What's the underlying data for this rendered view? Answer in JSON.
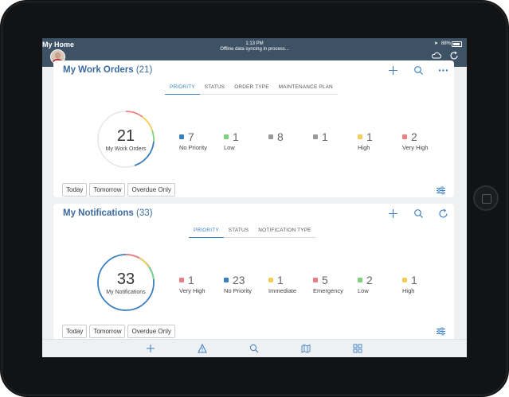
{
  "status_bar": {
    "app_name": "My Home",
    "time": "1:13 PM",
    "sync_message": "Offline data syncing in process...",
    "battery": "88%"
  },
  "work_orders": {
    "title": "My Work Orders",
    "count": "(21)",
    "tabs": [
      "PRIORITY",
      "STATUS",
      "ORDER TYPE",
      "MAINTENANCE PLAN"
    ],
    "active_tab": "PRIORITY",
    "total": "21",
    "total_label": "My Work Orders",
    "stats": [
      {
        "value": "7",
        "label": "No Priority",
        "color": "#3a7fc1"
      },
      {
        "value": "1",
        "label": "Low",
        "color": "#7dd37d"
      },
      {
        "value": "8",
        "label": "",
        "color": "#9a9a9a"
      },
      {
        "value": "1",
        "label": "",
        "color": "#9a9a9a"
      },
      {
        "value": "1",
        "label": "High",
        "color": "#f5cf5a"
      },
      {
        "value": "2",
        "label": "Very High",
        "color": "#f08080"
      }
    ],
    "filters": [
      "Today",
      "Tomorrow",
      "Overdue Only"
    ]
  },
  "notifications": {
    "title": "My Notifications",
    "count": "(33)",
    "tabs": [
      "PRIORITY",
      "STATUS",
      "NOTIFICATION TYPE"
    ],
    "active_tab": "PRIORITY",
    "total": "33",
    "total_label": "My Notifications",
    "stats": [
      {
        "value": "1",
        "label": "Very High",
        "color": "#f08080"
      },
      {
        "value": "23",
        "label": "No Priority",
        "color": "#3a7fc1"
      },
      {
        "value": "1",
        "label": "Immediate",
        "color": "#f5cf5a"
      },
      {
        "value": "5",
        "label": "Emergency",
        "color": "#f08080"
      },
      {
        "value": "2",
        "label": "Low",
        "color": "#7dd37d"
      },
      {
        "value": "1",
        "label": "High",
        "color": "#f5cf5a"
      }
    ],
    "filters": [
      "Today",
      "Tomorrow",
      "Overdue Only"
    ]
  },
  "bottom_nav": [
    "plus-icon",
    "warning-icon",
    "search-icon",
    "map-icon",
    "grid-icon"
  ],
  "colors": {
    "accent": "#3a7fc1",
    "header": "#3e5266",
    "title": "#3a6a9e"
  }
}
